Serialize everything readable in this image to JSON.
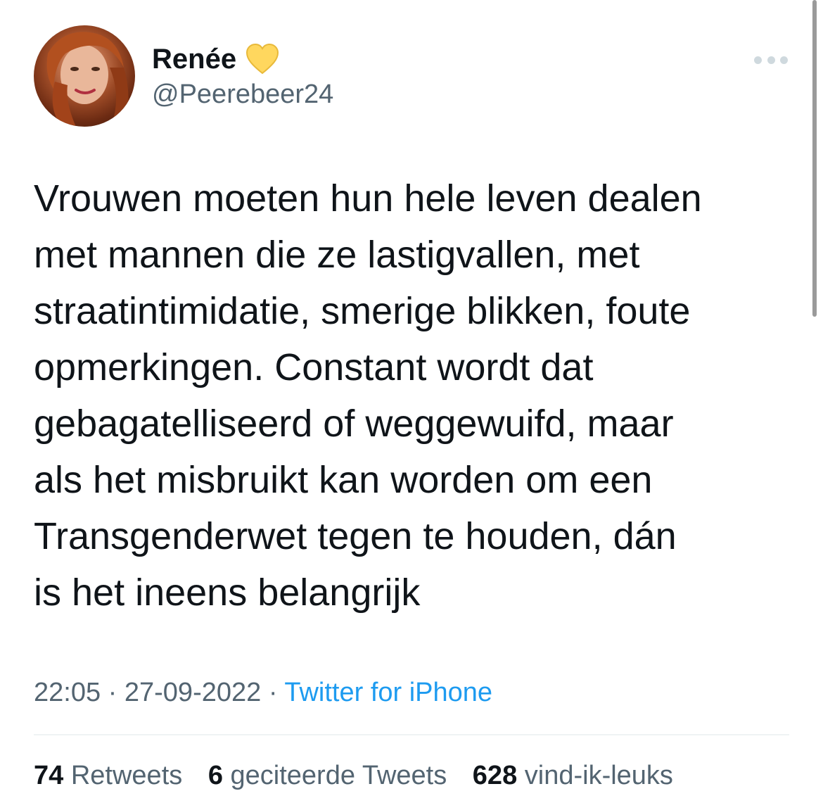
{
  "tweet": {
    "author": {
      "display_name": "Renée",
      "badge_icon": "yellow-heart-icon",
      "badge_color": "#ffd75e",
      "handle": "@Peerebeer24"
    },
    "text_lines": [
      "Vrouwen moeten hun hele leven dealen",
      "met mannen die ze lastigvallen, met",
      "straatintimidatie, smerige blikken, foute",
      "opmerkingen. Constant wordt dat",
      "gebagatelliseerd of weggewuifd, maar",
      "als het misbruikt kan worden om een",
      "Transgenderwet tegen te houden, dán",
      "is het ineens belangrijk"
    ],
    "time": "22:05",
    "separator": "·",
    "date": "27-09-2022",
    "source": "Twitter for iPhone",
    "stats": {
      "retweets_count": "74",
      "retweets_label": "Retweets",
      "quotes_count": "6",
      "quotes_label": "geciteerde Tweets",
      "likes_count": "628",
      "likes_label": "vind-ik-leuks"
    }
  },
  "colors": {
    "text": "#0f1419",
    "secondary": "#536471",
    "link": "#1d9bf0",
    "divider": "#eff3f4"
  }
}
